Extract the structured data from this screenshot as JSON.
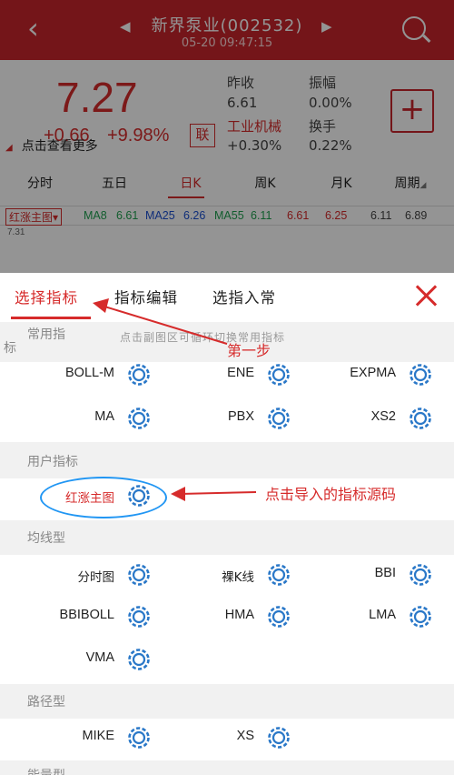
{
  "header": {
    "back_icon": "back-chevron-icon",
    "title": "新界泵业(002532)",
    "time": "05-20 09:47:15",
    "search_icon": "search-icon"
  },
  "quote": {
    "price": "7.27",
    "change": "+0.66",
    "change_pct": "+9.98%",
    "lian_label": "联",
    "more_label": "点击查看更多",
    "stats": {
      "prev_close_label": "昨收",
      "prev_close": "6.61",
      "amplitude_label": "振幅",
      "amplitude": "0.00%",
      "industry_label": "工业机械",
      "industry_change": "+0.30%",
      "turnover_label": "换手",
      "turnover": "0.22%"
    },
    "plus_label": "+"
  },
  "chart_tabs": [
    "分时",
    "五日",
    "日K",
    "周K",
    "月K",
    "周期"
  ],
  "ma_row": {
    "selector": "红涨主图",
    "ma8_label": "MA8",
    "ma8": "6.61",
    "ma25_label": "MA25",
    "ma25": "6.26",
    "ma55_label": "MA55",
    "ma55": "6.11",
    "v1": "6.61",
    "v2": "6.25",
    "v3": "6.11",
    "v4": "6.89",
    "small": "7.31"
  },
  "panel": {
    "tabs": [
      "选择指标",
      "指标编辑",
      "选指入常"
    ],
    "hint": "点击副图区可循环切换常用指标",
    "cut_label": "标",
    "sections": {
      "common": "常用指",
      "user": "用户指标",
      "ma_type": "均线型",
      "path_type": "路径型",
      "energy": "能量型"
    },
    "common_items": [
      "BOLL-M",
      "ENE",
      "EXPMA",
      "MA",
      "PBX",
      "XS2"
    ],
    "user_items": [
      "红涨主图"
    ],
    "ma_items": [
      "分时图",
      "裸K线",
      "BBI",
      "BBIBOLL",
      "HMA",
      "LMA",
      "VMA"
    ],
    "path_items": [
      "MIKE",
      "XS"
    ]
  },
  "annotations": {
    "step1": "第一步",
    "import_hint": "点击导入的指标源码"
  },
  "colors": {
    "brand_red": "#c9252c",
    "up_red": "#d62b2b",
    "highlight_blue": "#2196f3"
  }
}
